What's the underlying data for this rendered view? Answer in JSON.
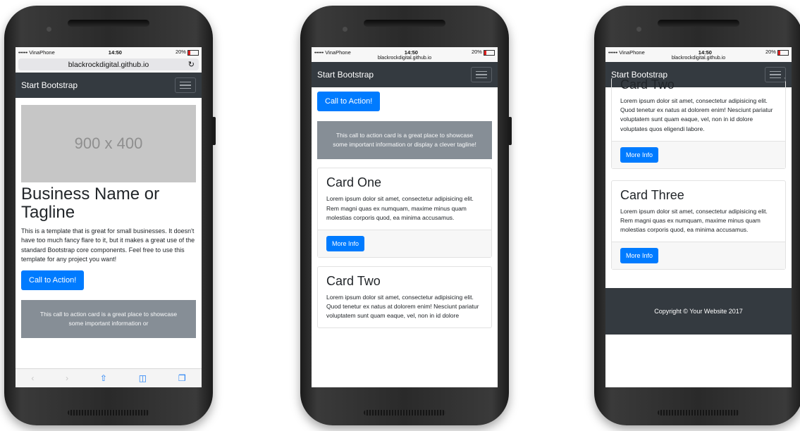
{
  "phone1": {
    "status": {
      "carrier": "••••• VinaPhone",
      "time": "14:50",
      "battery": "20%"
    },
    "url": "blackrockdigital.github.io",
    "brand": "Start Bootstrap",
    "placeholder": "900 x 400",
    "heading": "Business Name or Tagline",
    "lead": "This is a template that is great for small businesses. It doesn't have too much fancy flare to it, but it makes a great use of the standard Bootstrap core components. Feel free to use this template for any project you want!",
    "cta_button": "Call to Action!",
    "cta_text": "This call to action card is a great place to showcase some important information or",
    "toolbar_icons": [
      "back-icon",
      "forward-icon",
      "share-icon",
      "bookmarks-icon",
      "tabs-icon"
    ]
  },
  "phone2": {
    "status": {
      "carrier": "••••• VinaPhone",
      "time": "14:50",
      "battery": "20%"
    },
    "url": "blackrockdigital.github.io",
    "brand": "Start Bootstrap",
    "cta_button": "Call to Action!",
    "cta_text": "This call to action card is a great place to showcase some important information or display a clever tagline!",
    "card1": {
      "title": "Card One",
      "text": "Lorem ipsum dolor sit amet, consectetur adipisicing elit. Rem magni quas ex numquam, maxime minus quam molestias corporis quod, ea minima accusamus.",
      "button": "More Info"
    },
    "card2": {
      "title": "Card Two",
      "text": "Lorem ipsum dolor sit amet, consectetur adipisicing elit. Quod tenetur ex natus at dolorem enim! Nesciunt pariatur voluptatem sunt quam eaque, vel, non in id dolore"
    }
  },
  "phone3": {
    "status": {
      "carrier": "••••• VinaPhone",
      "time": "14:50",
      "battery": "20%"
    },
    "url": "blackrockdigital.github.io",
    "brand": "Start Bootstrap",
    "card2": {
      "title": "Card Two",
      "text": "Lorem ipsum dolor sit amet, consectetur adipisicing elit. Quod tenetur ex natus at dolorem enim! Nesciunt pariatur voluptatem sunt quam eaque, vel, non in id dolore voluptates quos eligendi labore.",
      "button": "More Info"
    },
    "card3": {
      "title": "Card Three",
      "text": "Lorem ipsum dolor sit amet, consectetur adipisicing elit. Rem magni quas ex numquam, maxime minus quam molestias corporis quod, ea minima accusamus.",
      "button": "More Info"
    },
    "footer": "Copyright © Your Website 2017"
  }
}
